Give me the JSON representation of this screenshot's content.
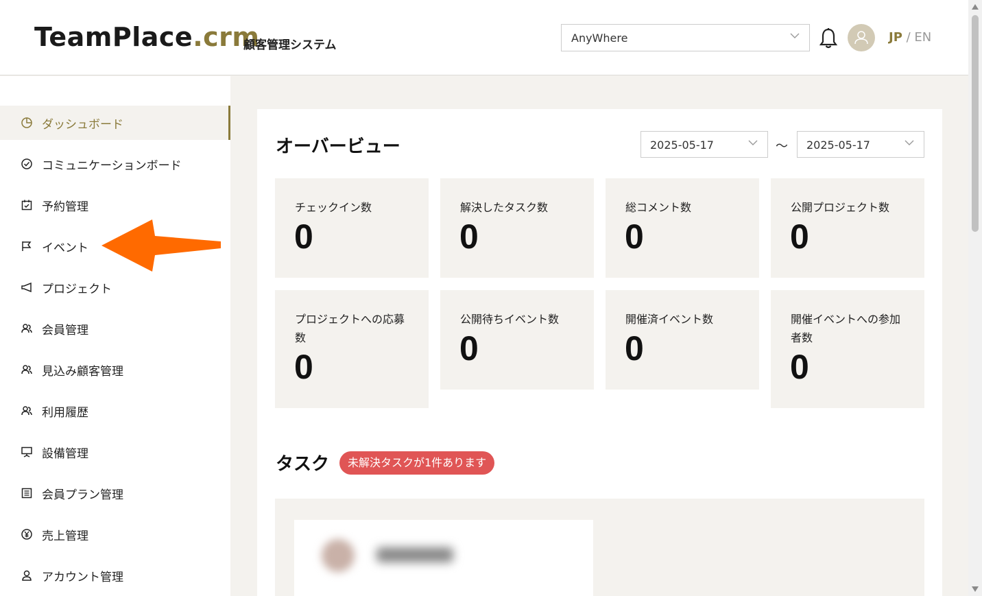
{
  "header": {
    "logo_main": "TeamPlace",
    "logo_suffix": ".crm",
    "subtitle": "顧客管理システム",
    "workspace": "AnyWhere",
    "lang_jp": "JP",
    "lang_sep": " / ",
    "lang_en": "EN"
  },
  "sidebar": {
    "items": [
      {
        "label": "ダッシュボード",
        "icon": "pie-chart-icon",
        "active": true
      },
      {
        "label": "コミュニケーションボード",
        "icon": "check-circle-icon"
      },
      {
        "label": "予約管理",
        "icon": "calendar-check-icon"
      },
      {
        "label": "イベント",
        "icon": "flag-icon"
      },
      {
        "label": "プロジェクト",
        "icon": "megaphone-icon"
      },
      {
        "label": "会員管理",
        "icon": "users-icon"
      },
      {
        "label": "見込み顧客管理",
        "icon": "users-icon"
      },
      {
        "label": "利用履歴",
        "icon": "users-icon"
      },
      {
        "label": "設備管理",
        "icon": "presentation-icon"
      },
      {
        "label": "会員プラン管理",
        "icon": "list-icon"
      },
      {
        "label": "売上管理",
        "icon": "yen-circle-icon"
      },
      {
        "label": "アカウント管理",
        "icon": "account-icon"
      }
    ]
  },
  "overview": {
    "title": "オーバービュー",
    "date_from": "2025-05-17",
    "date_to": "2025-05-17",
    "separator": "〜",
    "stats": [
      {
        "label": "チェックイン数",
        "value": "0"
      },
      {
        "label": "解決したタスク数",
        "value": "0"
      },
      {
        "label": "総コメント数",
        "value": "0"
      },
      {
        "label": "公開プロジェクト数",
        "value": "0"
      },
      {
        "label": "プロジェクトへの応募数",
        "value": "0"
      },
      {
        "label": "公開待ちイベント数",
        "value": "0"
      },
      {
        "label": "開催済イベント数",
        "value": "0"
      },
      {
        "label": "開催イベントへの参加者数",
        "value": "0"
      }
    ]
  },
  "tasks": {
    "title": "タスク",
    "badge": "未解決タスクが1件あります"
  },
  "colors": {
    "accent": "#8a7a3a",
    "badge": "#e05555",
    "arrow": "#ff6a00"
  }
}
